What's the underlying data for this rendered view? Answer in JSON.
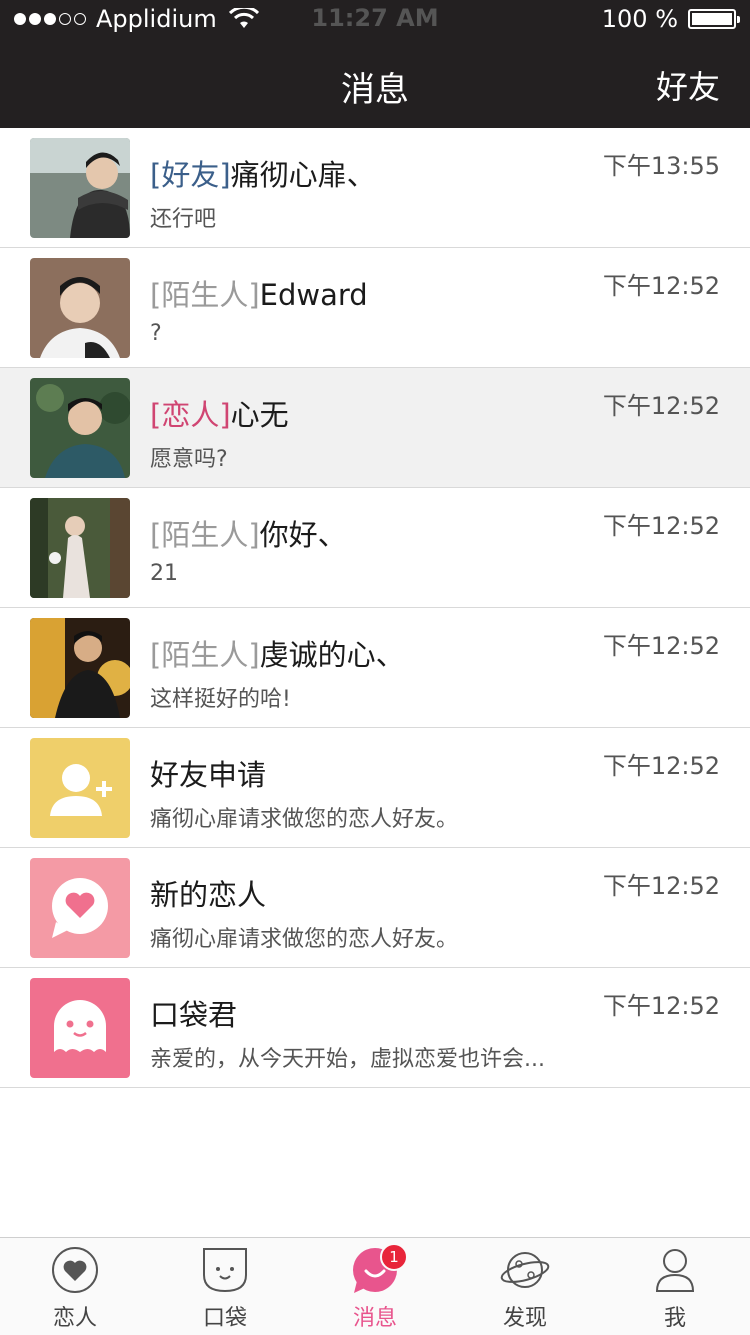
{
  "status_bar": {
    "carrier": "Applidium",
    "time": "11:27 AM",
    "battery": "100 %"
  },
  "nav": {
    "title": "消息",
    "right_button": "好友"
  },
  "messages": [
    {
      "tag": "[好友]",
      "tag_type": "friend",
      "name": "痛彻心扉、",
      "preview": "还行吧",
      "time": "下午13:55"
    },
    {
      "tag": "[陌生人]",
      "tag_type": "stranger",
      "name": "Edward",
      "preview": "?",
      "time": "下午12:52"
    },
    {
      "tag": "[恋人]",
      "tag_type": "lover",
      "name": "心无",
      "preview": "愿意吗?",
      "time": "下午12:52"
    },
    {
      "tag": "[陌生人]",
      "tag_type": "stranger",
      "name": "你好、",
      "preview": "21",
      "time": "下午12:52"
    },
    {
      "tag": "[陌生人]",
      "tag_type": "stranger",
      "name": "虔诚的心、",
      "preview": "这样挺好的哈!",
      "time": "下午12:52"
    },
    {
      "tag": "",
      "tag_type": "none",
      "name": "好友申请",
      "preview": "痛彻心扉请求做您的恋人好友。",
      "time": "下午12:52"
    },
    {
      "tag": "",
      "tag_type": "none",
      "name": "新的恋人",
      "preview": "痛彻心扉请求做您的恋人好友。",
      "time": "下午12:52"
    },
    {
      "tag": "",
      "tag_type": "none",
      "name": "口袋君",
      "preview": "亲爱的，从今天开始，虚拟恋爱也许会...",
      "time": "下午12:52"
    }
  ],
  "tabs": [
    {
      "label": "恋人",
      "icon": "heart-icon"
    },
    {
      "label": "口袋",
      "icon": "pocket-icon"
    },
    {
      "label": "消息",
      "icon": "message-icon",
      "badge": "1"
    },
    {
      "label": "发现",
      "icon": "planet-icon"
    },
    {
      "label": "我",
      "icon": "person-icon"
    }
  ],
  "colors": {
    "nav_bg": "#232021",
    "accent": "#e8558d",
    "friend_tag": "#3b5f8a",
    "stranger_tag": "#9a9a9a",
    "lover_tag": "#d04572",
    "friend_request_bg": "#efcf6a",
    "new_lover_bg": "#f49aa5",
    "pocket_bot_bg": "#f0708e"
  }
}
